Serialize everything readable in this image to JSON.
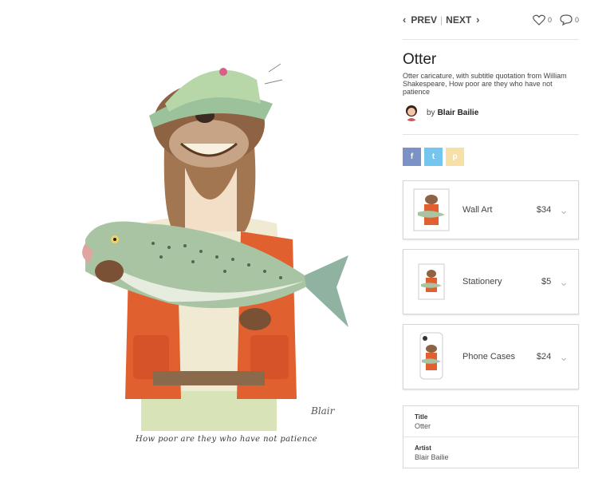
{
  "nav": {
    "prev_label": "PREV",
    "next_label": "NEXT",
    "likes": "0",
    "comments": "0"
  },
  "artwork": {
    "caption": "How poor are they who have not patience",
    "signature": "Blair"
  },
  "details": {
    "title": "Otter",
    "description": "Otter caricature, with subtitle quotation from William Shakespeare, How poor are they who have not patience",
    "by_prefix": "by",
    "artist": "Blair Bailie"
  },
  "share": {
    "facebook": "f",
    "twitter": "t",
    "pinterest": "p",
    "colors": {
      "facebook": "#7b92c7",
      "twitter": "#74c6ee",
      "pinterest": "#f7e0a6"
    }
  },
  "products": [
    {
      "name": "Wall Art",
      "price": "$34"
    },
    {
      "name": "Stationery",
      "price": "$5"
    },
    {
      "name": "Phone Cases",
      "price": "$24"
    }
  ],
  "info": [
    {
      "label": "Title",
      "value": "Otter"
    },
    {
      "label": "Artist",
      "value": "Blair Bailie"
    }
  ]
}
